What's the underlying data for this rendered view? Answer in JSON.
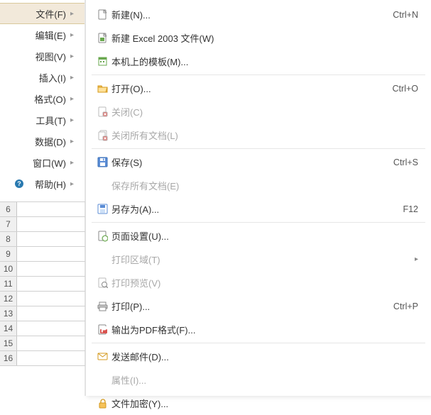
{
  "menubar": {
    "items": [
      {
        "label": "文件(F)",
        "icon": "",
        "selected": true,
        "hasSubmenu": true
      },
      {
        "label": "编辑(E)",
        "icon": "",
        "hasSubmenu": true
      },
      {
        "label": "视图(V)",
        "icon": "",
        "hasSubmenu": true
      },
      {
        "label": "插入(I)",
        "icon": "",
        "hasSubmenu": true
      },
      {
        "label": "格式(O)",
        "icon": "",
        "hasSubmenu": true
      },
      {
        "label": "工具(T)",
        "icon": "",
        "hasSubmenu": true
      },
      {
        "label": "数据(D)",
        "icon": "",
        "hasSubmenu": true
      },
      {
        "label": "窗口(W)",
        "icon": "",
        "hasSubmenu": true
      },
      {
        "label": "帮助(H)",
        "icon": "help",
        "hasSubmenu": true
      }
    ]
  },
  "rows": [
    "6",
    "7",
    "8",
    "9",
    "10",
    "11",
    "12",
    "13",
    "14",
    "15",
    "16"
  ],
  "submenu": {
    "groups": [
      [
        {
          "icon": "new-doc",
          "label": "新建(N)...",
          "hotkey": "Ctrl+N"
        },
        {
          "icon": "new-excel",
          "label": "新建 Excel 2003 文件(W)"
        },
        {
          "icon": "template",
          "label": "本机上的模板(M)..."
        }
      ],
      [
        {
          "icon": "open-folder",
          "label": "打开(O)...",
          "hotkey": "Ctrl+O"
        },
        {
          "icon": "close-doc",
          "label": "关闭(C)",
          "disabled": true
        },
        {
          "icon": "close-all",
          "label": "关闭所有文档(L)",
          "disabled": true
        }
      ],
      [
        {
          "icon": "save",
          "label": "保存(S)",
          "hotkey": "Ctrl+S"
        },
        {
          "icon": "",
          "label": "保存所有文档(E)",
          "disabled": true
        },
        {
          "icon": "save-as",
          "label": "另存为(A)...",
          "hotkey": "F12"
        }
      ],
      [
        {
          "icon": "page-setup",
          "label": "页面设置(U)..."
        },
        {
          "icon": "",
          "label": "打印区域(T)",
          "disabled": true,
          "hasSubmenu": true
        },
        {
          "icon": "print-preview",
          "label": "打印预览(V)",
          "disabled": true
        },
        {
          "icon": "print",
          "label": "打印(P)...",
          "hotkey": "Ctrl+P"
        },
        {
          "icon": "export-pdf",
          "label": "输出为PDF格式(F)..."
        }
      ],
      [
        {
          "icon": "send-mail",
          "label": "发送邮件(D)..."
        },
        {
          "icon": "",
          "label": "属性(I)...",
          "disabled": true
        },
        {
          "icon": "encrypt",
          "label": "文件加密(Y)..."
        }
      ]
    ]
  },
  "icons": {
    "arrow": "▸"
  }
}
